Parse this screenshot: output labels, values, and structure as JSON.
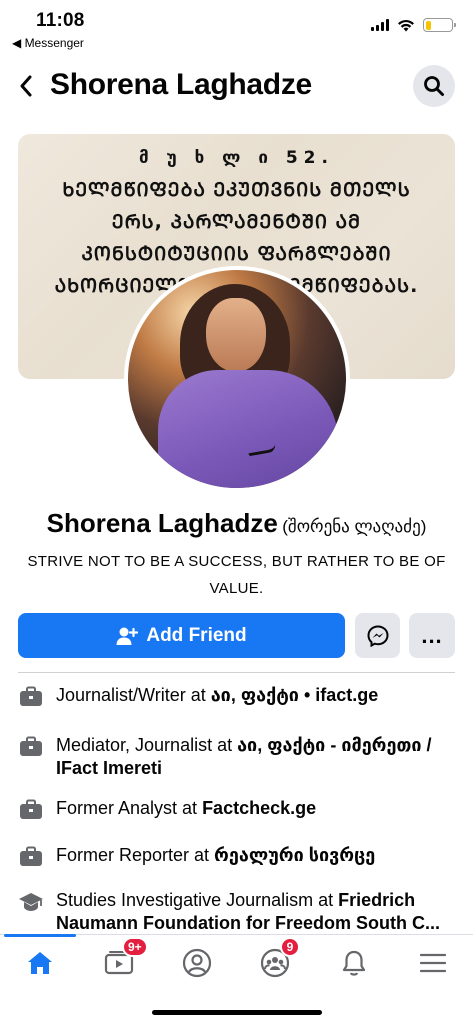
{
  "status_bar": {
    "time": "11:08",
    "back_app": "◀ Messenger",
    "battery_level": 0.2
  },
  "header": {
    "title": "Shorena Laghadze"
  },
  "cover": {
    "lines": [
      "მ უ ხ ლ ი  52.",
      "ᲮᲔᲚᲛᲬᲘᲤᲔᲑᲐ ᲔᲙᲣᲗᲕᲜᲘᲡ ᲛᲗᲔᲚᲡ",
      "ᲔᲠᲡ, ᲞᲐᲠᲚᲐᲛᲔᲜᲢᲨᲘ ᲐᲛ",
      "ᲙᲝᲜᲡᲢᲘᲢᲣᲪᲘᲘᲡ ᲤᲐᲠᲒᲚᲔᲑᲨᲘ",
      "ᲐᲮᲝᲠᲪᲘᲔᲚᲓ... ...ᲘᲚᲔᲛᲬᲘᲤᲔᲑᲐᲡ."
    ]
  },
  "profile": {
    "name": "Shorena Laghadze",
    "alt_name": "(შორენა ლაღაძე)",
    "bio": "STRIVE NOT TO BE A SUCCESS, BUT RATHER TO BE OF VALUE."
  },
  "actions": {
    "add_friend": "Add Friend",
    "more": "..."
  },
  "details": [
    {
      "icon": "briefcase-icon",
      "prefix": "Journalist/Writer at ",
      "bold": "აი, ფაქტი • ifact.ge"
    },
    {
      "icon": "briefcase-icon",
      "prefix": "Mediator, Journalist at ",
      "bold": "აი, ფაქტი - იმერეთი / IFact Imereti"
    },
    {
      "icon": "briefcase-icon",
      "prefix": "Former Analyst at ",
      "bold": "Factcheck.ge"
    },
    {
      "icon": "briefcase-icon",
      "prefix": "Former Reporter at ",
      "bold": "რეალური სივრცე"
    },
    {
      "icon": "graduation-cap-icon",
      "prefix": "Studies Investigative Journalism at ",
      "bold": "Friedrich Naumann Foundation for Freedom South C..."
    }
  ],
  "tabbar": {
    "video_badge": "9+",
    "groups_badge": "9"
  },
  "colors": {
    "accent": "#1877f2",
    "badge": "#e41e3f",
    "button_gray": "#e4e6eb"
  }
}
